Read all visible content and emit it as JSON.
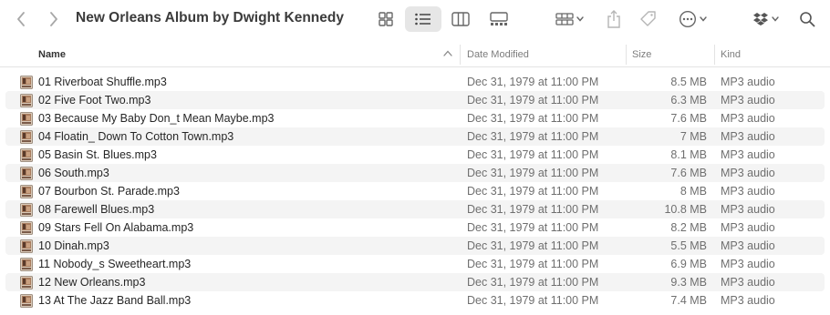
{
  "window": {
    "title": "New Orleans Album by Dwight Kennedy"
  },
  "toolbar": {
    "back_icon": "chevron-left-icon",
    "forward_icon": "chevron-right-icon",
    "active_view": "list"
  },
  "columns": {
    "name": "Name",
    "date": "Date Modified",
    "size": "Size",
    "kind": "Kind",
    "sort": "ascending"
  },
  "files": [
    {
      "name": "01 Riverboat Shuffle.mp3",
      "date": "Dec 31, 1979 at 11:00 PM",
      "size": "8.5 MB",
      "kind": "MP3 audio"
    },
    {
      "name": "02 Five Foot Two.mp3",
      "date": "Dec 31, 1979 at 11:00 PM",
      "size": "6.3 MB",
      "kind": "MP3 audio"
    },
    {
      "name": "03 Because My Baby Don_t Mean Maybe.mp3",
      "date": "Dec 31, 1979 at 11:00 PM",
      "size": "7.6 MB",
      "kind": "MP3 audio"
    },
    {
      "name": "04 Floatin_ Down To Cotton Town.mp3",
      "date": "Dec 31, 1979 at 11:00 PM",
      "size": "7 MB",
      "kind": "MP3 audio"
    },
    {
      "name": "05 Basin St. Blues.mp3",
      "date": "Dec 31, 1979 at 11:00 PM",
      "size": "8.1 MB",
      "kind": "MP3 audio"
    },
    {
      "name": "06 South.mp3",
      "date": "Dec 31, 1979 at 11:00 PM",
      "size": "7.6 MB",
      "kind": "MP3 audio"
    },
    {
      "name": "07 Bourbon St. Parade.mp3",
      "date": "Dec 31, 1979 at 11:00 PM",
      "size": "8 MB",
      "kind": "MP3 audio"
    },
    {
      "name": "08 Farewell Blues.mp3",
      "date": "Dec 31, 1979 at 11:00 PM",
      "size": "10.8 MB",
      "kind": "MP3 audio"
    },
    {
      "name": "09 Stars Fell On Alabama.mp3",
      "date": "Dec 31, 1979 at 11:00 PM",
      "size": "8.2 MB",
      "kind": "MP3 audio"
    },
    {
      "name": "10 Dinah.mp3",
      "date": "Dec 31, 1979 at 11:00 PM",
      "size": "5.5 MB",
      "kind": "MP3 audio"
    },
    {
      "name": "11 Nobody_s Sweetheart.mp3",
      "date": "Dec 31, 1979 at 11:00 PM",
      "size": "6.9 MB",
      "kind": "MP3 audio"
    },
    {
      "name": "12 New Orleans.mp3",
      "date": "Dec 31, 1979 at 11:00 PM",
      "size": "9.3 MB",
      "kind": "MP3 audio"
    },
    {
      "name": "13 At The Jazz Band Ball.mp3",
      "date": "Dec 31, 1979 at 11:00 PM",
      "size": "7.4 MB",
      "kind": "MP3 audio"
    }
  ]
}
